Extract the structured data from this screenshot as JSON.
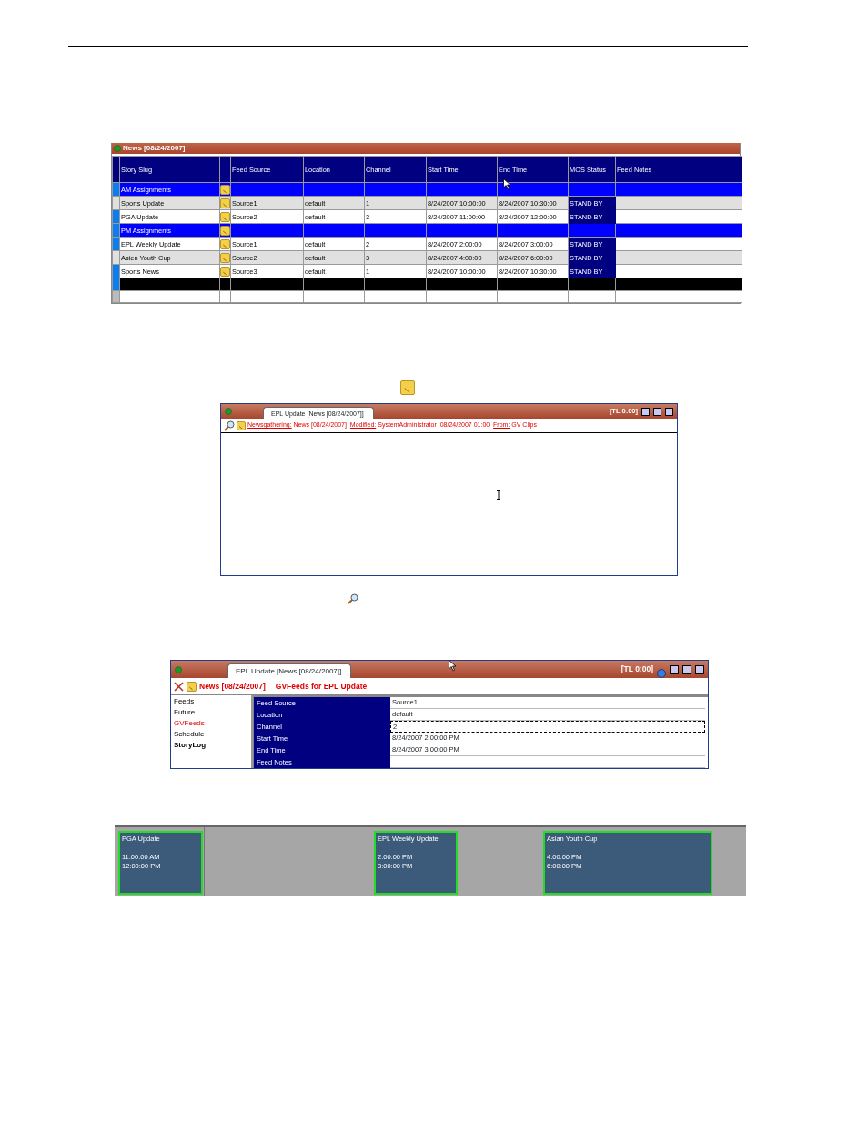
{
  "rundown": {
    "title": "News [08/24/2007]",
    "columns": [
      "Story Slug",
      "",
      "Feed Source",
      "Location",
      "Channel",
      "Start Time",
      "End Time",
      "MOS Status",
      "Feed Notes"
    ],
    "rows": [
      {
        "kind": "group",
        "slug": "AM Assignments"
      },
      {
        "kind": "story",
        "slug": "Sports Update",
        "shaded": true,
        "feed_source": "Source1",
        "location": "default",
        "channel": "1",
        "start_time": "8/24/2007 10:00:00",
        "end_time": "8/24/2007 10:30:00",
        "mos_status": "STAND BY"
      },
      {
        "kind": "story",
        "slug": "PGA Update",
        "shaded": false,
        "feed_source": "Source2",
        "location": "default",
        "channel": "3",
        "start_time": "8/24/2007 11:00:00",
        "end_time": "8/24/2007 12:00:00",
        "mos_status": "STAND BY"
      },
      {
        "kind": "group",
        "slug": "PM Assignments"
      },
      {
        "kind": "story",
        "slug": "EPL Weekly Update",
        "shaded": false,
        "feed_source": "Source1",
        "location": "default",
        "channel": "2",
        "start_time": "8/24/2007 2:00:00",
        "end_time": "8/24/2007 3:00:00",
        "mos_status": "STAND BY"
      },
      {
        "kind": "story",
        "slug": "Asien Youth Cup",
        "shaded": true,
        "feed_source": "Source2",
        "location": "default",
        "channel": "3",
        "start_time": "8/24/2007 4:00:00",
        "end_time": "8/24/2007 6:00:00",
        "mos_status": "STAND BY"
      },
      {
        "kind": "story",
        "slug": "Sports News",
        "shaded": false,
        "feed_source": "Source3",
        "location": "default",
        "channel": "1",
        "start_time": "8/24/2007 10:00:00",
        "end_time": "8/24/2007 10:30:00",
        "mos_status": "STAND BY"
      },
      {
        "kind": "divider"
      },
      {
        "kind": "blank"
      }
    ]
  },
  "story_window": {
    "tab": "EPL Update [News [08/24/2007]]",
    "timer": "[TL 0:00]",
    "info": [
      {
        "kind": "link",
        "text": "Newsgathering:"
      },
      {
        "kind": "text",
        "text": " News [08/24/2007]  "
      },
      {
        "kind": "link",
        "text": "Modified:"
      },
      {
        "kind": "text",
        "text": " SystemAdministrator  08/24/2007 01:00  "
      },
      {
        "kind": "link",
        "text": "From:"
      },
      {
        "kind": "text",
        "text": " GV Clips"
      }
    ]
  },
  "feed_window": {
    "tab": "EPL Update [News [08/24/2007]]",
    "timer": "[TL 0:00]",
    "heading": "News [08/24/2007]",
    "subheading": "GVFeeds for EPL Update",
    "nav": [
      {
        "label": "Feeds",
        "selected": false,
        "emphasized": false
      },
      {
        "label": "Future",
        "selected": false,
        "emphasized": false
      },
      {
        "label": "GVFeeds",
        "selected": true,
        "emphasized": false
      },
      {
        "label": "Schedule",
        "selected": false,
        "emphasized": false
      },
      {
        "label": "StoryLog",
        "selected": false,
        "emphasized": true
      }
    ],
    "fields": [
      {
        "label": "Feed Source",
        "value": "Source1",
        "focused": false
      },
      {
        "label": "Location",
        "value": "default",
        "focused": false
      },
      {
        "label": "Channel",
        "value": "2",
        "focused": true
      },
      {
        "label": "Start Time",
        "value": "8/24/2007 2:00:00 PM",
        "focused": false
      },
      {
        "label": "End Time",
        "value": "8/24/2007 3:00:00 PM",
        "focused": false
      },
      {
        "label": "Feed Notes",
        "focused": false
      }
    ]
  },
  "timeline": {
    "blocks": [
      {
        "title": "PGA Update",
        "start": "11:00:00 AM",
        "end": "12:00:00 PM"
      },
      {
        "title": "EPL Weekly Update",
        "start": "2:00:00 PM",
        "end": "3:00:00 PM"
      },
      {
        "title": "Asian Youth Cup",
        "start": "4:00:00 PM",
        "end": "6:00:00 PM"
      }
    ]
  }
}
